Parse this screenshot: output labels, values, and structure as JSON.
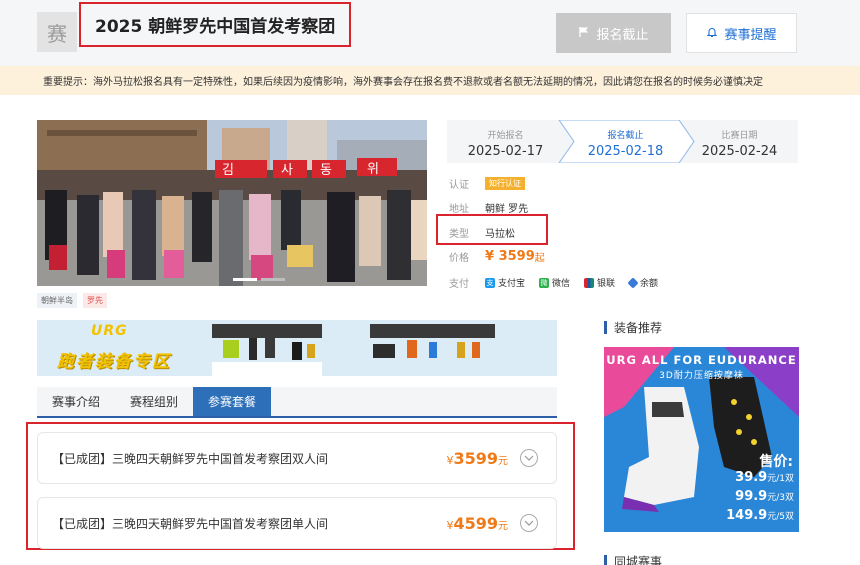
{
  "header": {
    "logo_char": "赛",
    "title": "2025 朝鲜罗先中国首发考察团",
    "closed_button": "报名截止",
    "remind_button": "赛事提醒"
  },
  "notice": "重要提示：海外马拉松报名具有一定特殊性，如果后续因为疫情影响，海外赛事会存在报名费不退款或者名额无法延期的情况，因此请您在报名的时候务必谨慎决定",
  "photo": {
    "sign_chars": [
      "김",
      "사",
      "동",
      "위"
    ]
  },
  "tags": [
    "朝鲜半岛",
    "罗先"
  ],
  "timeline": [
    {
      "label": "开始报名",
      "date": "2025-02-17"
    },
    {
      "label": "报名截止",
      "date": "2025-02-18"
    },
    {
      "label": "比赛日期",
      "date": "2025-02-24"
    }
  ],
  "info": {
    "cert_key": "认证",
    "cert_val": "知行认证",
    "addr_key": "地址",
    "addr_val": "朝鲜  罗先",
    "type_key": "类型",
    "type_val": "马拉松",
    "price_key": "价格",
    "price_val": "¥ 3599",
    "price_unit": "起",
    "pay_key": "支付",
    "pay_methods": [
      "支付宝",
      "微信",
      "银联",
      "余额"
    ]
  },
  "banner": {
    "logo": "URG",
    "slogan": "跑者装备专区"
  },
  "tabs": [
    "赛事介绍",
    "赛程组别",
    "参赛套餐"
  ],
  "packages": [
    {
      "name": "【已成团】三晚四天朝鲜罗先中国首发考察团双人间",
      "currency": "¥",
      "price": "3599",
      "unit": "元"
    },
    {
      "name": "【已成团】三晚四天朝鲜罗先中国首发考察团单人间",
      "currency": "¥",
      "price": "4599",
      "unit": "元"
    }
  ],
  "side": {
    "gear_title": "装备推荐",
    "ad_head": "URG ALL FOR EUDURANCE",
    "ad_sub": "3D耐力压缩按摩袜",
    "ad_price_label": "售价:",
    "ad_prices": [
      {
        "value": "39.9",
        "unit": "元/1双"
      },
      {
        "value": "99.9",
        "unit": "元/3双"
      },
      {
        "value": "149.9",
        "unit": "元/5双"
      }
    ],
    "city_title": "同城赛事"
  },
  "colors": {
    "accent_blue": "#1f6fd4",
    "tab_blue": "#2d6fb8",
    "price_orange": "#f07a18",
    "highlight_red": "#d9232d",
    "notice_bg": "#fdf1dc"
  }
}
